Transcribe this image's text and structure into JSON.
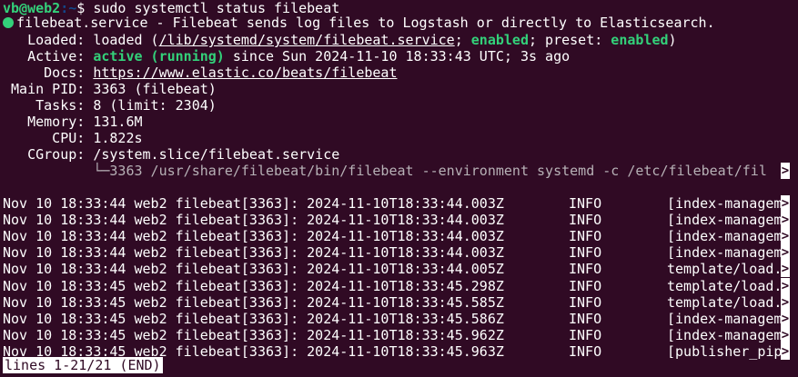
{
  "prompt": {
    "user_host": "vb@web2",
    "path": ":~",
    "symbol": "$ ",
    "command": "sudo systemctl status filebeat"
  },
  "service": {
    "header": "filebeat.service - Filebeat sends log files to Logstash or directly to Elasticsearch.",
    "loaded_label": "   Loaded: ",
    "loaded_pre": "loaded (",
    "loaded_path": "/lib/systemd/system/filebeat.service",
    "loaded_mid": "; ",
    "loaded_enabled": "enabled",
    "loaded_preset_label": "; preset: ",
    "loaded_preset": "enabled",
    "loaded_post": ")",
    "active_label": "   Active: ",
    "active_state": "active (running)",
    "active_since": " since Sun 2024-11-10 18:33:43 UTC; 3s ago",
    "docs_label": "     Docs: ",
    "docs_url": "https://www.elastic.co/beats/filebeat",
    "pid_label": " Main PID: ",
    "pid_value": "3363 (filebeat)",
    "tasks_label": "    Tasks: ",
    "tasks_value": "8 (limit: 2304)",
    "memory_label": "   Memory: ",
    "memory_value": "131.6M",
    "cpu_label": "      CPU: ",
    "cpu_value": "1.822s",
    "cgroup_label": "   CGroup: ",
    "cgroup_value": "/system.slice/filebeat.service",
    "cgroup_tree": "           └─",
    "cgroup_process": "3363 /usr/share/filebeat/bin/filebeat --environment systemd -c /etc/filebeat/fil"
  },
  "truncation_marker": ">",
  "logs": [
    {
      "prefix": "Nov 10 18:33:44 web2 filebeat[3363]: 2024-11-10T18:33:44.003Z",
      "level": "INFO",
      "logger": "[index-managem"
    },
    {
      "prefix": "Nov 10 18:33:44 web2 filebeat[3363]: 2024-11-10T18:33:44.003Z",
      "level": "INFO",
      "logger": "[index-managem"
    },
    {
      "prefix": "Nov 10 18:33:44 web2 filebeat[3363]: 2024-11-10T18:33:44.003Z",
      "level": "INFO",
      "logger": "[index-managem"
    },
    {
      "prefix": "Nov 10 18:33:44 web2 filebeat[3363]: 2024-11-10T18:33:44.003Z",
      "level": "INFO",
      "logger": "[index-managem"
    },
    {
      "prefix": "Nov 10 18:33:44 web2 filebeat[3363]: 2024-11-10T18:33:44.005Z",
      "level": "INFO",
      "logger": "template/load."
    },
    {
      "prefix": "Nov 10 18:33:45 web2 filebeat[3363]: 2024-11-10T18:33:45.298Z",
      "level": "INFO",
      "logger": "template/load."
    },
    {
      "prefix": "Nov 10 18:33:45 web2 filebeat[3363]: 2024-11-10T18:33:45.585Z",
      "level": "INFO",
      "logger": "template/load."
    },
    {
      "prefix": "Nov 10 18:33:45 web2 filebeat[3363]: 2024-11-10T18:33:45.586Z",
      "level": "INFO",
      "logger": "[index-managem"
    },
    {
      "prefix": "Nov 10 18:33:45 web2 filebeat[3363]: 2024-11-10T18:33:45.962Z",
      "level": "INFO",
      "logger": "[index-managem"
    },
    {
      "prefix": "Nov 10 18:33:45 web2 filebeat[3363]: 2024-11-10T18:33:45.963Z",
      "level": "INFO",
      "logger": "[publisher_pip"
    }
  ],
  "pager_status": "lines 1-21/21 (END)",
  "colors": {
    "background": "#300a24",
    "prompt_green": "#33d17a",
    "prompt_blue": "#12488b",
    "status_green": "#33d17a"
  }
}
